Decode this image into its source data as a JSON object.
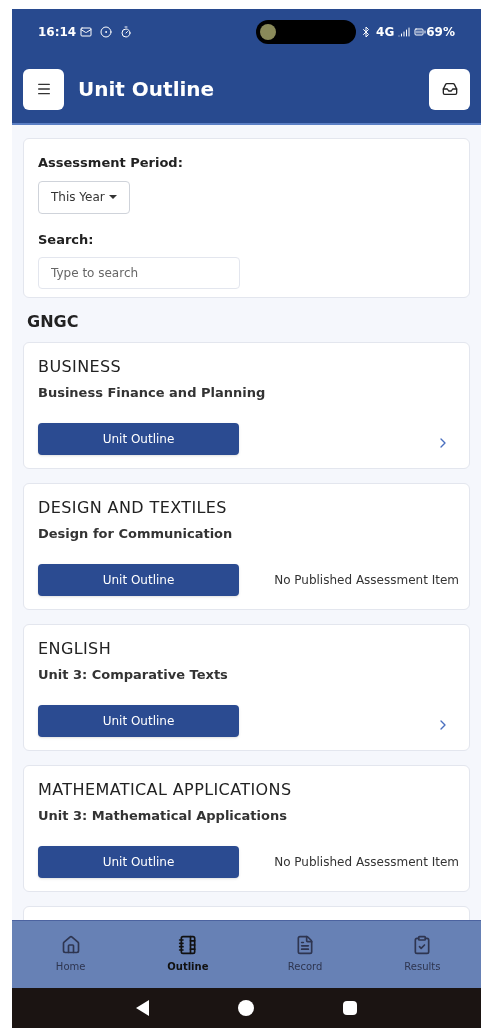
{
  "status_bar": {
    "time": "16:14",
    "network": "4G",
    "battery": "69%"
  },
  "header": {
    "title": "Unit Outline"
  },
  "filters": {
    "period_label": "Assessment Period:",
    "period_value": "This Year",
    "search_label": "Search:",
    "search_placeholder": "Type to search"
  },
  "group": "GNGC",
  "units": [
    {
      "subject": "BUSINESS",
      "name": "Business Finance and Planning",
      "button": "Unit Outline",
      "kind": "link"
    },
    {
      "subject": "DESIGN AND TEXTILES",
      "name": "Design for Communication",
      "button": "Unit Outline",
      "kind": "note",
      "note": "No Published Assessment Item"
    },
    {
      "subject": "ENGLISH",
      "name": "Unit 3: Comparative Texts",
      "button": "Unit Outline",
      "kind": "link"
    },
    {
      "subject": "MATHEMATICAL APPLICATIONS",
      "name": "Unit 3: Mathematical Applications",
      "button": "Unit Outline",
      "kind": "note",
      "note": "No Published Assessment Item"
    }
  ],
  "nav": [
    {
      "label": "Home",
      "selected": false
    },
    {
      "label": "Outline",
      "selected": true
    },
    {
      "label": "Record",
      "selected": false
    },
    {
      "label": "Results",
      "selected": false
    }
  ]
}
